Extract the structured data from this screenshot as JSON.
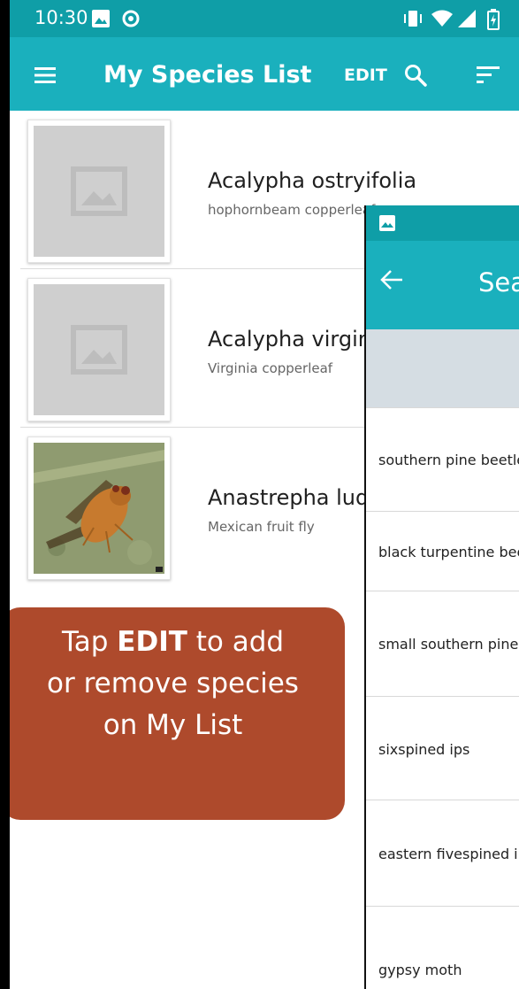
{
  "status_bar": {
    "time": "10:30"
  },
  "app_bar": {
    "title": "My Species List",
    "edit_label": "EDIT"
  },
  "species": [
    {
      "scientific_name": "Acalypha ostryifolia",
      "common_name": "hophornbeam copperleaf",
      "has_image": false
    },
    {
      "scientific_name": "Acalypha virginica",
      "common_name": "Virginia copperleaf",
      "has_image": false
    },
    {
      "scientific_name": "Anastrepha ludens",
      "common_name": "Mexican fruit fly",
      "has_image": true
    }
  ],
  "overlay": {
    "title": "Search",
    "items": [
      {
        "label": "southern pine beetle"
      },
      {
        "label": "black turpentine beetle"
      },
      {
        "label": "small southern pine engraver"
      },
      {
        "label": "sixspined ips"
      },
      {
        "label": "eastern fivespined ips"
      },
      {
        "label": "gypsy moth"
      }
    ]
  },
  "tooltip": {
    "before": "Tap ",
    "emphasis": "EDIT",
    "after": " to add",
    "line2": "or remove species",
    "line3": "on My List"
  },
  "colors": {
    "status_bar": "#0f9ea7",
    "app_bar": "#1ab0bd",
    "callout": "#ae4a2c",
    "search_strip": "#d5dde3"
  }
}
